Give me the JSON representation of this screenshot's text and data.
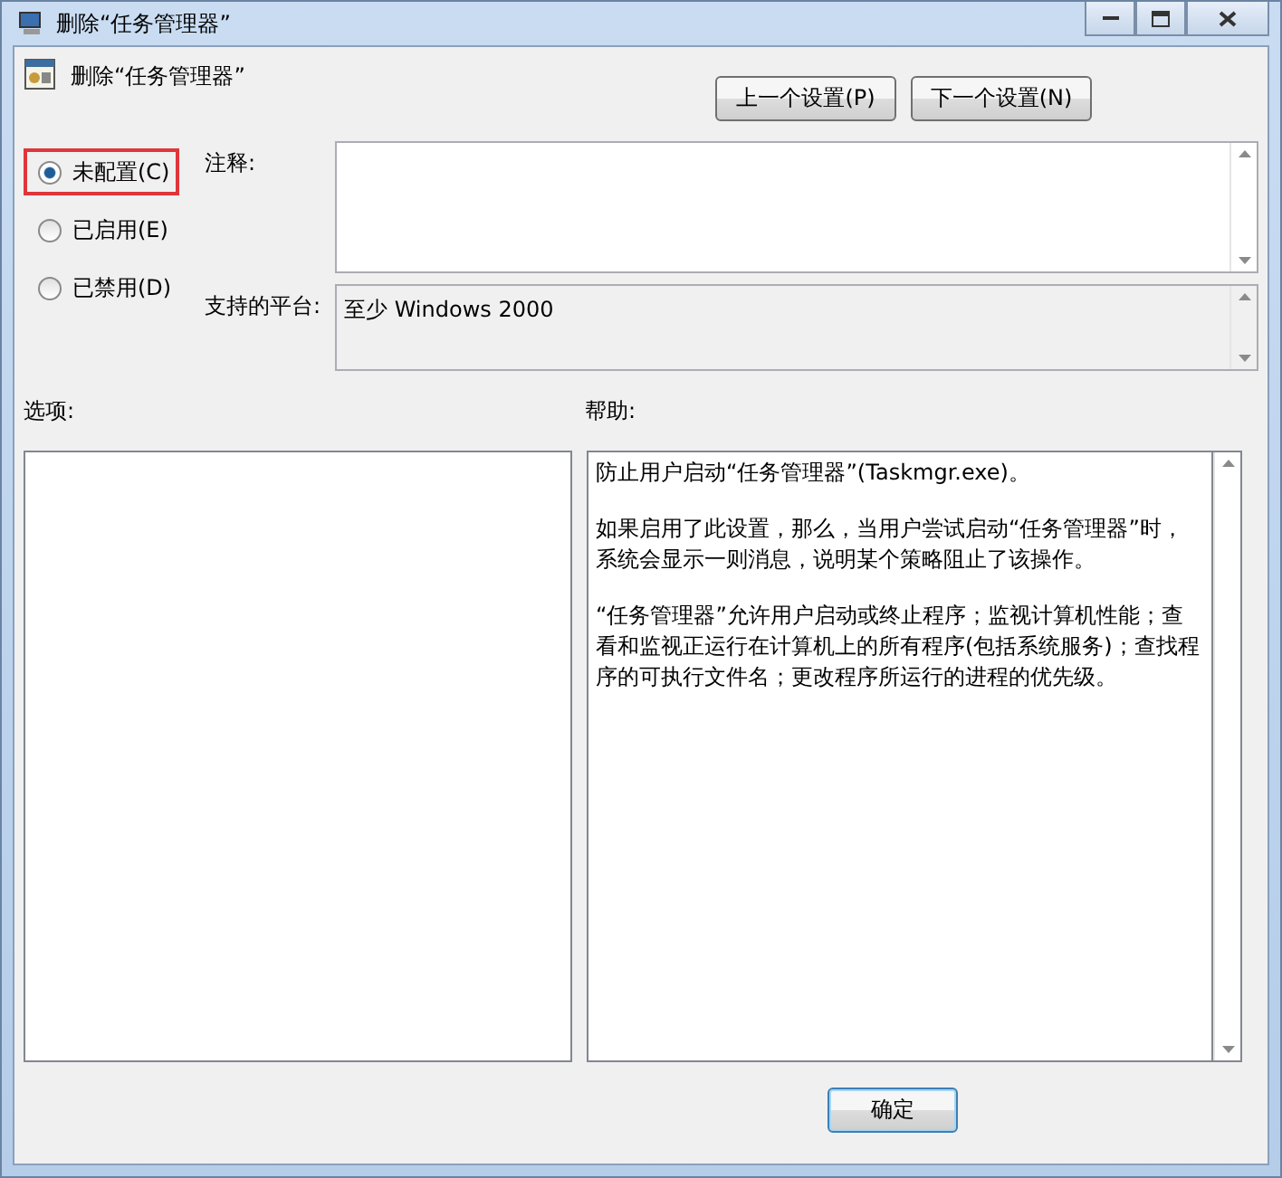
{
  "window": {
    "title": "删除“任务管理器”"
  },
  "header": {
    "title": "删除“任务管理器”"
  },
  "nav_buttons": [
    "上一个设置(P)",
    "下一个设置(N)"
  ],
  "state_options": [
    {
      "label": "未配置(C)",
      "selected": true,
      "highlighted": true
    },
    {
      "label": "已启用(E)",
      "selected": false,
      "highlighted": false
    },
    {
      "label": "已禁用(D)",
      "selected": false,
      "highlighted": false
    }
  ],
  "comment": {
    "label": "注释:"
  },
  "platform": {
    "label": "支持的平台:",
    "value": "至少 Windows 2000"
  },
  "options": {
    "label": "选项:"
  },
  "help": {
    "label": "帮助:",
    "paragraphs": [
      "防止用户启动“任务管理器”(Taskmgr.exe)。",
      "如果启用了此设置，那么，当用户尝试启动“任务管理器”时，系统会显示一则消息，说明某个策略阻止了该操作。",
      "“任务管理器”允许用户启动或终止程序；监视计算机性能；查看和监视正运行在计算机上的所有程序(包括系统服务)；查找程序的可执行文件名；更改程序所运行的进程的优先级。"
    ]
  },
  "buttons": [
    "确定"
  ]
}
